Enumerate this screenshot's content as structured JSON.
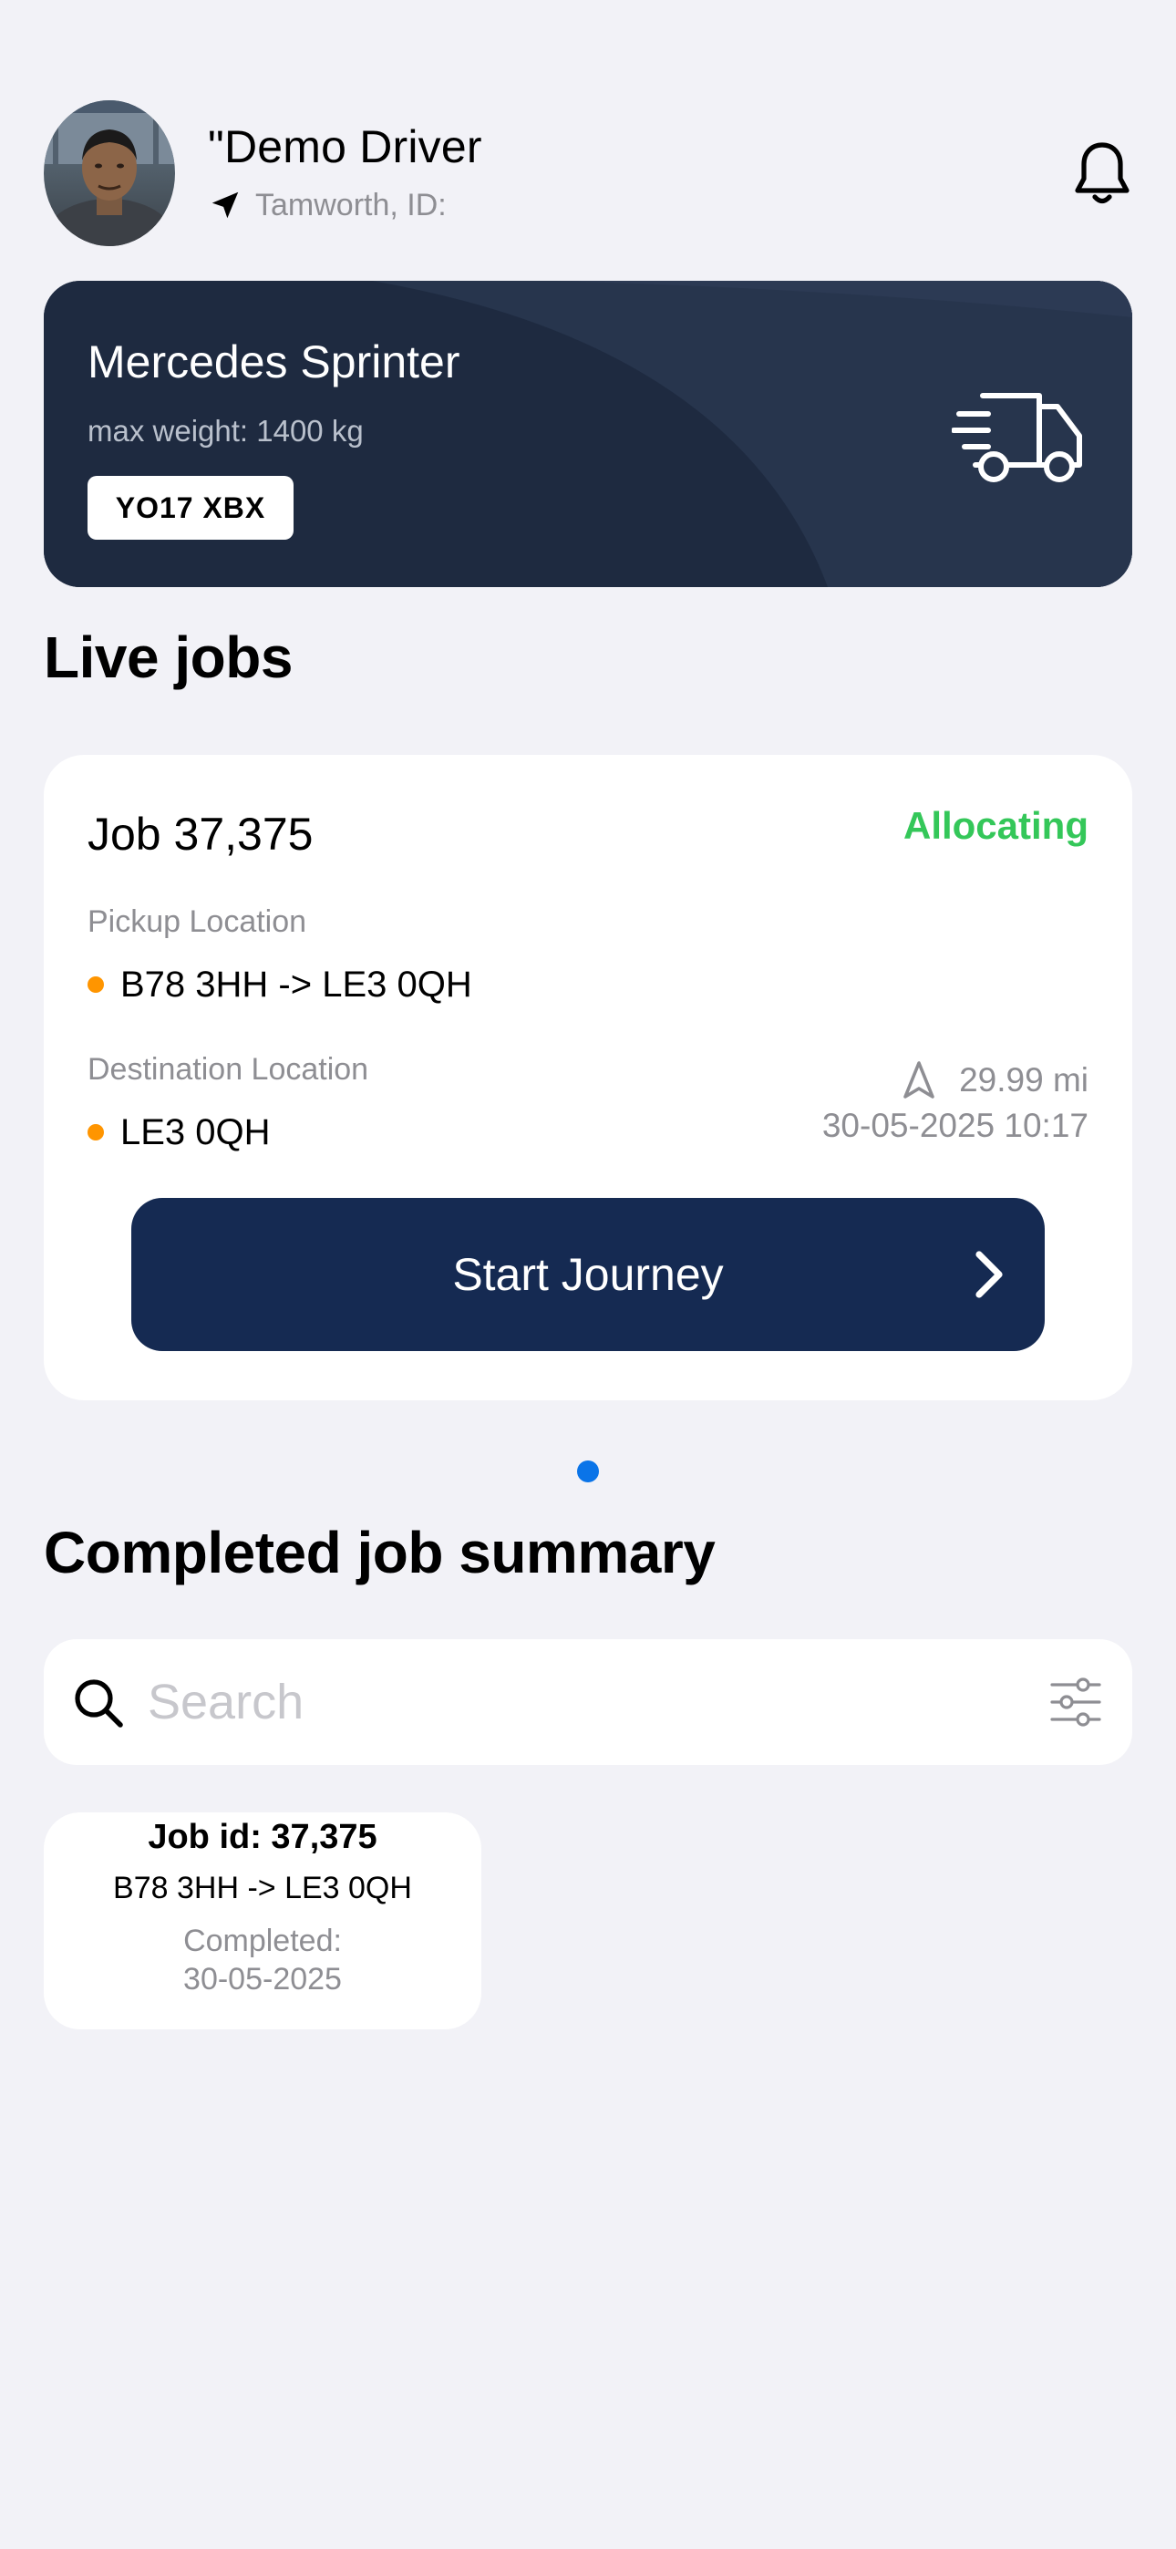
{
  "header": {
    "driver_name": "\"Demo Driver",
    "location": "Tamworth, ID:"
  },
  "vehicle": {
    "name": "Mercedes Sprinter",
    "max_weight": "max weight: 1400 kg",
    "plate": "YO17 XBX"
  },
  "live_jobs": {
    "title": "Live jobs",
    "job": {
      "title": "Job 37,375",
      "status": "Allocating",
      "status_color": "#34c759",
      "pickup_label": "Pickup Location",
      "pickup_value": "B78 3HH -> LE3 0QH",
      "destination_label": "Destination Location",
      "destination_value": "LE3 0QH",
      "distance": "29.99 mi",
      "datetime": "30-05-2025 10:17",
      "button_label": "Start Journey",
      "marker_color": "#ff9500"
    },
    "pager": {
      "page_count": 1,
      "active_page": 1
    }
  },
  "completed": {
    "title": "Completed job summary",
    "search_placeholder": "Search",
    "items": [
      {
        "id": "Job id: 37,375",
        "route": "B78 3HH -> LE3 0QH",
        "completed_label": "Completed:",
        "completed_date": "30-05-2025"
      }
    ]
  },
  "icons": {
    "location": "location-arrow-icon",
    "notifications": "bell-icon",
    "vehicle": "delivery-truck-icon",
    "distance": "navigation-icon",
    "start": "chevron-right-icon",
    "search": "search-icon",
    "filter": "filter-sliders-icon"
  },
  "colors": {
    "background": "#f2f2f7",
    "vehicle_card": "#1f2b42",
    "primary_button": "#152a52",
    "page_indicator": "#0a74e8"
  }
}
